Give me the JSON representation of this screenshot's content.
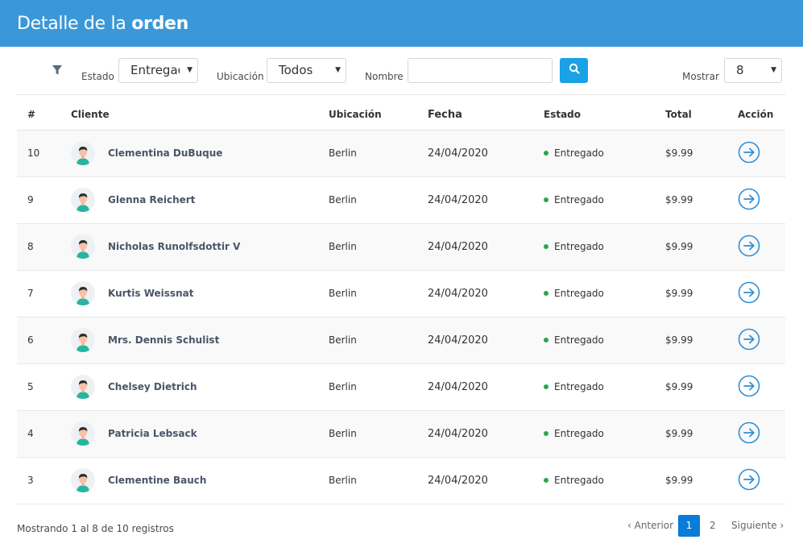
{
  "header": {
    "title_prefix": "Detalle de la",
    "title_bold": "orden"
  },
  "filters": {
    "estado_label": "Estado",
    "estado_value": "Entregado",
    "ubicacion_label": "Ubicación",
    "ubicacion_value": "Todos",
    "nombre_label": "Nombre",
    "nombre_value": "",
    "mostrar_label": "Mostrar",
    "mostrar_value": "8"
  },
  "table": {
    "headers": [
      "#",
      "Cliente",
      "Ubicación",
      "Fecha",
      "Estado",
      "Total",
      "Acción"
    ],
    "rows": [
      {
        "id": "10",
        "client": "Clementina DuBuque",
        "location": "Berlin",
        "date": "24/04/2020",
        "status": "Entregado",
        "total": "$9.99"
      },
      {
        "id": "9",
        "client": "Glenna Reichert",
        "location": "Berlin",
        "date": "24/04/2020",
        "status": "Entregado",
        "total": "$9.99"
      },
      {
        "id": "8",
        "client": "Nicholas Runolfsdottir V",
        "location": "Berlin",
        "date": "24/04/2020",
        "status": "Entregado",
        "total": "$9.99"
      },
      {
        "id": "7",
        "client": "Kurtis Weissnat",
        "location": "Berlin",
        "date": "24/04/2020",
        "status": "Entregado",
        "total": "$9.99"
      },
      {
        "id": "6",
        "client": "Mrs. Dennis Schulist",
        "location": "Berlin",
        "date": "24/04/2020",
        "status": "Entregado",
        "total": "$9.99"
      },
      {
        "id": "5",
        "client": "Chelsey Dietrich",
        "location": "Berlin",
        "date": "24/04/2020",
        "status": "Entregado",
        "total": "$9.99"
      },
      {
        "id": "4",
        "client": "Patricia Lebsack",
        "location": "Berlin",
        "date": "24/04/2020",
        "status": "Entregado",
        "total": "$9.99"
      },
      {
        "id": "3",
        "client": "Clementine Bauch",
        "location": "Berlin",
        "date": "24/04/2020",
        "status": "Entregado",
        "total": "$9.99"
      }
    ]
  },
  "footer": {
    "summary": "Mostrando 1 al 8 de 10 registros"
  },
  "pagination": {
    "prev": "‹ Anterior",
    "pages": [
      "1",
      "2"
    ],
    "active": "1",
    "next": "Siguiente ›"
  },
  "colors": {
    "header_bg": "#3a98d8",
    "accent": "#1aa1e6",
    "status_green": "#28a745",
    "active_page": "#0a7bd8"
  },
  "icons": {
    "filter": "filter-icon",
    "search": "search-icon",
    "action": "arrow-right-circle-icon",
    "avatar": "user-avatar-icon"
  }
}
